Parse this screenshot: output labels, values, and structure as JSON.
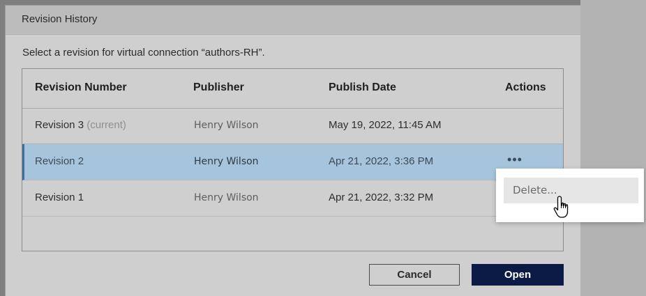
{
  "dialog": {
    "title": "Revision History",
    "subtitle": "Select a revision for virtual connection “authors-RH”."
  },
  "table": {
    "columns": [
      "Revision Number",
      "Publisher",
      "Publish Date",
      "Actions"
    ],
    "rows": [
      {
        "revision": "Revision 3",
        "current_tag": "(current)",
        "publisher": "Henry Wilson",
        "date": "May 19, 2022, 11:45 AM"
      },
      {
        "revision": "Revision 2",
        "current_tag": "",
        "publisher": "Henry Wilson",
        "date": "Apr 21, 2022, 3:36 PM",
        "actions": "•••",
        "selected": true
      },
      {
        "revision": "Revision 1",
        "current_tag": "",
        "publisher": "Henry Wilson",
        "date": "Apr 21, 2022, 3:32 PM"
      }
    ]
  },
  "footer": {
    "cancel_label": "Cancel",
    "open_label": "Open"
  },
  "context_menu": {
    "items": [
      "Delete..."
    ]
  },
  "colors": {
    "selected_row": "#a6c5dc",
    "primary_button": "#0c1a46"
  },
  "icons": {
    "actions": "more-horizontal-icon",
    "cursor": "hand-pointer-icon"
  }
}
